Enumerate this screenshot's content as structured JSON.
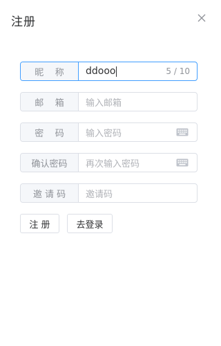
{
  "dialog": {
    "title": "注册",
    "close_icon": "close-icon"
  },
  "form": {
    "nickname": {
      "label": "昵    称",
      "value": "ddooo",
      "count": "5 / 10"
    },
    "email": {
      "label": "邮    箱",
      "placeholder": "输入邮箱"
    },
    "password": {
      "label": "密    码",
      "placeholder": "输入密码",
      "icon": "keyboard-icon"
    },
    "confirm_password": {
      "label": "确认密码",
      "placeholder": "再次输入密码",
      "icon": "keyboard-icon"
    },
    "invite_code": {
      "label": "邀 请 码",
      "placeholder": "邀请码"
    }
  },
  "actions": {
    "register_label": "注 册",
    "login_label": "去登录"
  },
  "colors": {
    "focus_border": "#409eff",
    "border": "#dcdfe6",
    "label_bg": "#f5f7fa"
  }
}
